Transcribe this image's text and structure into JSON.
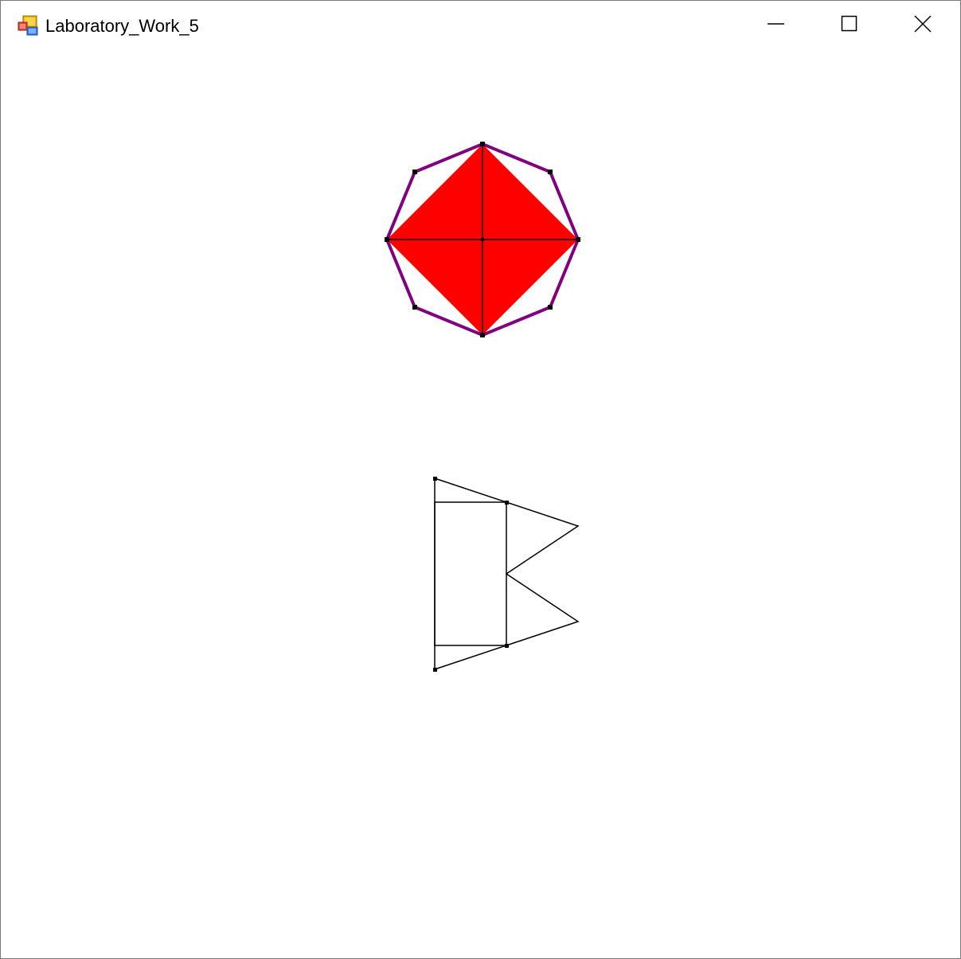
{
  "window": {
    "title": "Laboratory_Work_5",
    "app_icon": "winforms-app-icon",
    "controls": {
      "minimize_icon": "minimize-icon",
      "maximize_icon": "maximize-icon",
      "close_icon": "close-icon"
    }
  },
  "colors": {
    "diamond_fill": "#ff0000",
    "octagon_stroke": "#800080",
    "line_stroke": "#000000",
    "background": "#ffffff"
  },
  "drawing": {
    "shapes": [
      "octagon",
      "diamond",
      "cross-lines",
      "rectangle-with-triangles"
    ]
  }
}
